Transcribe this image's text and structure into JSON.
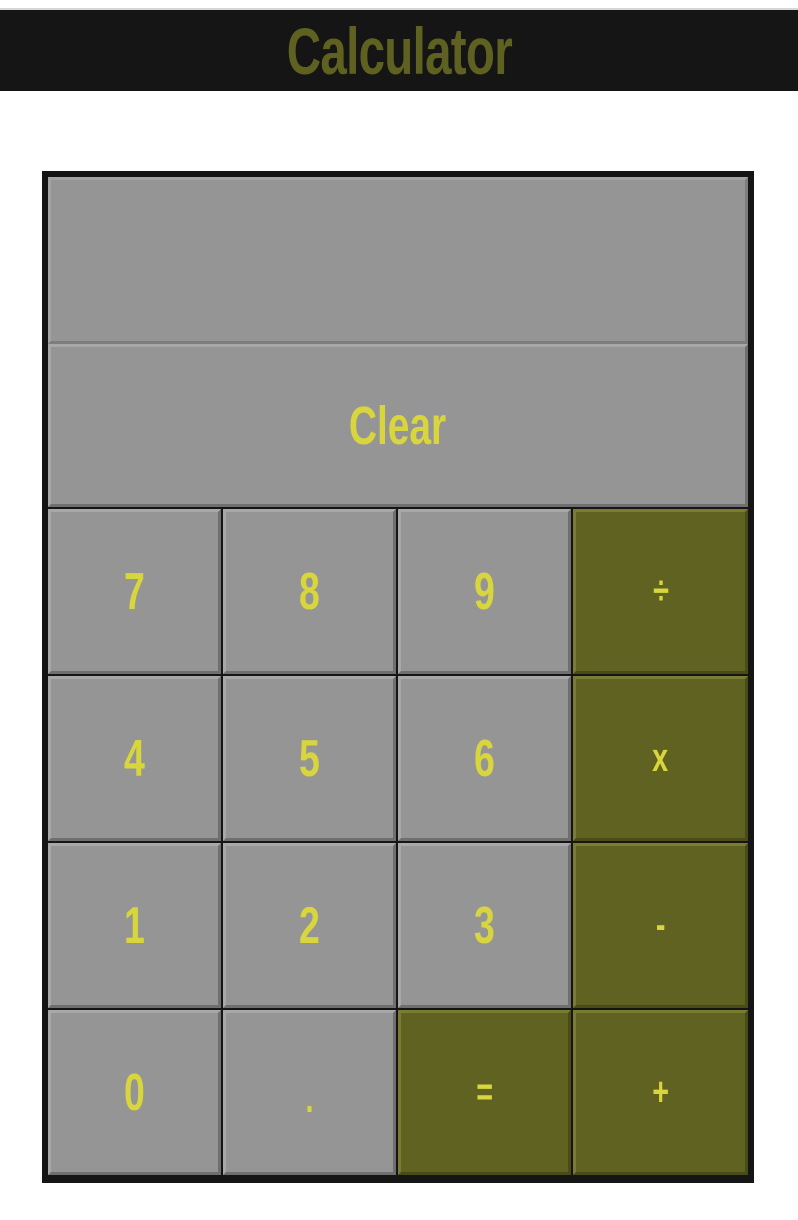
{
  "app": {
    "title": "Calculator"
  },
  "display": {
    "value": ""
  },
  "buttons": {
    "clear": "Clear",
    "seven": "7",
    "eight": "8",
    "nine": "9",
    "divide": "÷",
    "four": "4",
    "five": "5",
    "six": "6",
    "multiply": "x",
    "one": "1",
    "two": "2",
    "three": "3",
    "subtract": "-",
    "zero": "0",
    "decimal": ".",
    "equals": "=",
    "add": "+"
  },
  "colors": {
    "header_background": "#151515",
    "title_text": "#5f6120",
    "button_gray": "#959595",
    "button_operator": "#606221",
    "button_text": "#d8d63c",
    "frame": "#151515"
  }
}
